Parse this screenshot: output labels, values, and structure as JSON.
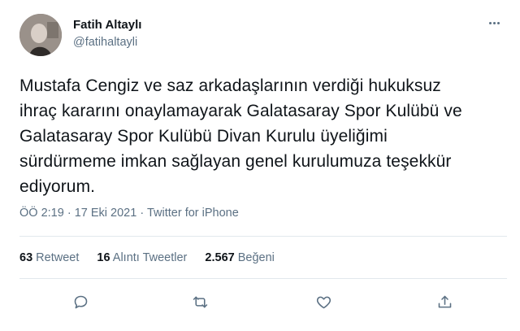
{
  "author": {
    "display_name": "Fatih Altaylı",
    "handle": "@fatihaltayli",
    "avatar_icon": "user-avatar"
  },
  "tweet": {
    "text": "Mustafa Cengiz ve saz arkadaşlarının verdiği hukuksuz ihraç kararını onaylamayarak Galatasaray Spor Kulübü ve Galatasaray Spor Kulübü Divan Kurulu üyeliğimi sürdürmeme imkan sağlayan genel kurulumuza teşekkür ediyorum.",
    "time": "ÖÖ 2:19",
    "separator": "·",
    "date": "17 Eki 2021",
    "source": "Twitter for iPhone"
  },
  "stats": {
    "retweets_count": "63",
    "retweets_label": "Retweet",
    "quotes_count": "16",
    "quotes_label": "Alıntı Tweetler",
    "likes_count": "2.567",
    "likes_label": "Beğeni"
  },
  "actions": {
    "reply_icon": "reply-icon",
    "retweet_icon": "retweet-icon",
    "like_icon": "like-icon",
    "share_icon": "share-icon",
    "more_icon": "more-icon"
  },
  "colors": {
    "text": "#0f1419",
    "secondary": "#5b7083",
    "divider": "#e1e8ed"
  }
}
